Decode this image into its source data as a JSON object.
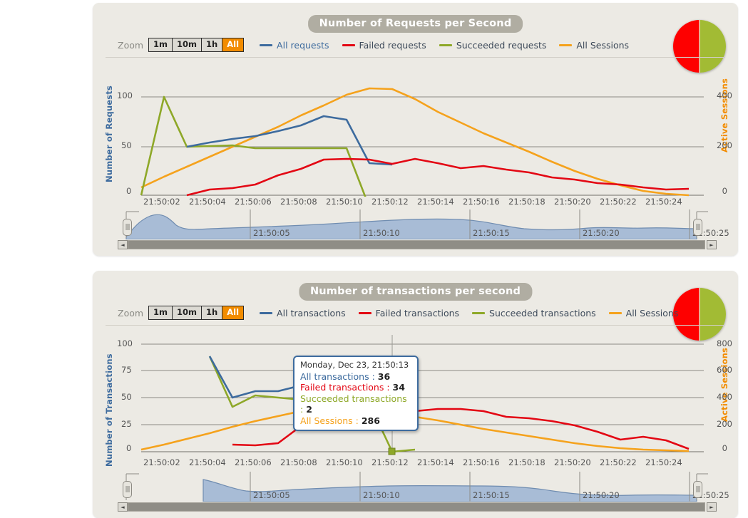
{
  "colors": {
    "all": "#3d6b9e",
    "failed": "#e30613",
    "succeeded": "#8ea828",
    "sessions": "#f5a21c",
    "accent": "#f28c00",
    "panel_bg": "#eceae4",
    "title_pill": "#b0ada2",
    "nav_area": "#a8bcd6"
  },
  "panels": [
    {
      "id": "requests",
      "title": "Number of Requests per Second",
      "zoom_label": "Zoom",
      "zoom_buttons": [
        {
          "label": "1m",
          "active": false
        },
        {
          "label": "10m",
          "active": false
        },
        {
          "label": "1h",
          "active": false
        },
        {
          "label": "All",
          "active": true
        }
      ],
      "legend": [
        {
          "label": "All requests",
          "color": "#3d6b9e"
        },
        {
          "label": "Failed requests",
          "color": "#e30613"
        },
        {
          "label": "Succeeded requests",
          "color": "#8ea828"
        },
        {
          "label": "All Sessions",
          "color": "#f5a21c"
        }
      ],
      "y_left_title": "Number of Requests",
      "y_right_title": "Active Sessions",
      "y_left_ticks": [
        "0",
        "50",
        "100"
      ],
      "y_right_ticks": [
        "0",
        "200",
        "400"
      ],
      "x_ticks": [
        "21:50:02",
        "21:50:04",
        "21:50:06",
        "21:50:08",
        "21:50:10",
        "21:50:12",
        "21:50:14",
        "21:50:16",
        "21:50:18",
        "21:50:20",
        "21:50:22",
        "21:50:24"
      ],
      "nav_ticks": [
        "21:50:05",
        "21:50:10",
        "21:50:15",
        "21:50:20",
        "21:50:25"
      ],
      "pie": {
        "red_pct": 49.5,
        "green_pct": 50.5
      }
    },
    {
      "id": "transactions",
      "title": "Number of transactions per second",
      "zoom_label": "Zoom",
      "zoom_buttons": [
        {
          "label": "1m",
          "active": false
        },
        {
          "label": "10m",
          "active": false
        },
        {
          "label": "1h",
          "active": false
        },
        {
          "label": "All",
          "active": true
        }
      ],
      "legend": [
        {
          "label": "All transactions",
          "color": "#3d6b9e"
        },
        {
          "label": "Failed transactions",
          "color": "#e30613"
        },
        {
          "label": "Succeeded transactions",
          "color": "#8ea828"
        },
        {
          "label": "All Sessions",
          "color": "#f5a21c"
        }
      ],
      "y_left_title": "Number of Transactions",
      "y_right_title": "Active Sessions",
      "y_left_ticks": [
        "0",
        "25",
        "50",
        "75",
        "100"
      ],
      "y_right_ticks": [
        "0",
        "200",
        "400",
        "600",
        "800"
      ],
      "x_ticks": [
        "21:50:02",
        "21:50:04",
        "21:50:06",
        "21:50:08",
        "21:50:10",
        "21:50:12",
        "21:50:14",
        "21:50:16",
        "21:50:18",
        "21:50:20",
        "21:50:22",
        "21:50:24"
      ],
      "nav_ticks": [
        "21:50:05",
        "21:50:10",
        "21:50:15",
        "21:50:20",
        "21:50:25"
      ],
      "pie": {
        "red_pct": 49.5,
        "green_pct": 50.5
      },
      "tooltip": {
        "date": "Monday, Dec 23, 21:50:13",
        "rows": [
          {
            "label": "All transactions :",
            "value": "36",
            "color": "#3d6b9e"
          },
          {
            "label": "Failed transactions :",
            "value": "34",
            "color": "#e30613"
          },
          {
            "label": "Succeeded transactions :",
            "value": "2",
            "color": "#8ea828"
          },
          {
            "label": "All Sessions :",
            "value": "286",
            "color": "#f5a21c"
          }
        ]
      }
    }
  ],
  "chart_data": [
    {
      "type": "line",
      "title": "Number of Requests per Second",
      "xlabel": "",
      "ylabel": "Number of Requests",
      "y2label": "Active Sessions",
      "ylim": [
        0,
        110
      ],
      "y2lim": [
        0,
        440
      ],
      "grid": true,
      "legend_position": "top",
      "x": [
        "21:50:01",
        "21:50:02",
        "21:50:03",
        "21:50:04",
        "21:50:05",
        "21:50:06",
        "21:50:07",
        "21:50:08",
        "21:50:09",
        "21:50:10",
        "21:50:11",
        "21:50:12",
        "21:50:13",
        "21:50:14",
        "21:50:15",
        "21:50:16",
        "21:50:17",
        "21:50:18",
        "21:50:19",
        "21:50:20",
        "21:50:21",
        "21:50:22",
        "21:50:23",
        "21:50:24",
        "21:50:25"
      ],
      "series": [
        {
          "name": "All requests",
          "axis": "left",
          "color": "#3d6b9e",
          "values": [
            null,
            null,
            46,
            50,
            54,
            57,
            62,
            68,
            76,
            72,
            32,
            null,
            null,
            null,
            null,
            null,
            null,
            null,
            null,
            null,
            null,
            null,
            null,
            null,
            null
          ]
        },
        {
          "name": "Failed requests",
          "axis": "left",
          "color": "#e30613",
          "values": [
            null,
            null,
            0,
            6,
            7,
            11,
            20,
            26,
            36,
            37,
            36,
            32,
            46,
            42,
            40,
            43,
            39,
            34,
            28,
            27,
            22,
            18,
            16,
            17,
            14
          ]
        },
        {
          "name": "Succeeded requests",
          "axis": "left",
          "color": "#8ea828",
          "values": [
            0,
            98,
            46,
            47,
            48,
            45,
            45,
            45,
            45,
            45,
            0,
            null,
            null,
            null,
            null,
            null,
            null,
            null,
            null,
            null,
            null,
            null,
            null,
            null,
            null
          ]
        },
        {
          "name": "All Sessions",
          "axis": "right",
          "color": "#f5a21c",
          "values": [
            28,
            60,
            92,
            124,
            158,
            192,
            228,
            268,
            310,
            352,
            398,
            396,
            362,
            322,
            288,
            252,
            220,
            188,
            154,
            122,
            96,
            72,
            52,
            34,
            12
          ]
        }
      ],
      "pie": {
        "type": "pie",
        "labels": [
          "Failed",
          "Succeeded"
        ],
        "values": [
          49.5,
          50.5
        ],
        "colors": [
          "#fe0000",
          "#a2bb34"
        ]
      }
    },
    {
      "type": "line",
      "title": "Number of transactions per second",
      "xlabel": "",
      "ylabel": "Number of Transactions",
      "y2label": "Active Sessions",
      "ylim": [
        0,
        110
      ],
      "y2lim": [
        0,
        880
      ],
      "grid": true,
      "legend_position": "top",
      "x": [
        "21:50:01",
        "21:50:02",
        "21:50:03",
        "21:50:04",
        "21:50:05",
        "21:50:06",
        "21:50:07",
        "21:50:08",
        "21:50:09",
        "21:50:10",
        "21:50:11",
        "21:50:12",
        "21:50:13",
        "21:50:14",
        "21:50:15",
        "21:50:16",
        "21:50:17",
        "21:50:18",
        "21:50:19",
        "21:50:20",
        "21:50:21",
        "21:50:22",
        "21:50:23",
        "21:50:24",
        "21:50:25"
      ],
      "series": [
        {
          "name": "All transactions",
          "axis": "left",
          "color": "#3d6b9e",
          "values": [
            null,
            null,
            null,
            92,
            50,
            61,
            61,
            72,
            78,
            78,
            77,
            24,
            36,
            null,
            null,
            null,
            null,
            null,
            null,
            null,
            null,
            null,
            null,
            null,
            null
          ]
        },
        {
          "name": "Failed transactions",
          "axis": "left",
          "color": "#e30613",
          "values": [
            null,
            null,
            null,
            null,
            7,
            6,
            8,
            24,
            28,
            28,
            25,
            44,
            34,
            28,
            28,
            26,
            24,
            22,
            19,
            14,
            8,
            11,
            9,
            6,
            1
          ]
        },
        {
          "name": "Succeeded transactions",
          "axis": "left",
          "color": "#8ea828",
          "values": [
            null,
            null,
            null,
            92,
            42,
            53,
            50,
            48,
            47,
            46,
            45,
            0,
            2,
            null,
            null,
            null,
            null,
            null,
            null,
            null,
            null,
            null,
            null,
            null,
            null
          ]
        },
        {
          "name": "All Sessions",
          "axis": "right",
          "color": "#f5a21c",
          "values": [
            14,
            52,
            94,
            140,
            186,
            232,
            272,
            310,
            346,
            372,
            382,
            286,
            262,
            236,
            206,
            176,
            146,
            116,
            90,
            62,
            40,
            24,
            14,
            8,
            4
          ]
        }
      ],
      "highlight": {
        "x": "21:50:13",
        "all_transactions": 36,
        "failed_transactions": 34,
        "succeeded_transactions": 2,
        "all_sessions": 286
      },
      "pie": {
        "type": "pie",
        "labels": [
          "Failed",
          "Succeeded"
        ],
        "values": [
          49.5,
          50.5
        ],
        "colors": [
          "#fe0000",
          "#a2bb34"
        ]
      }
    }
  ]
}
